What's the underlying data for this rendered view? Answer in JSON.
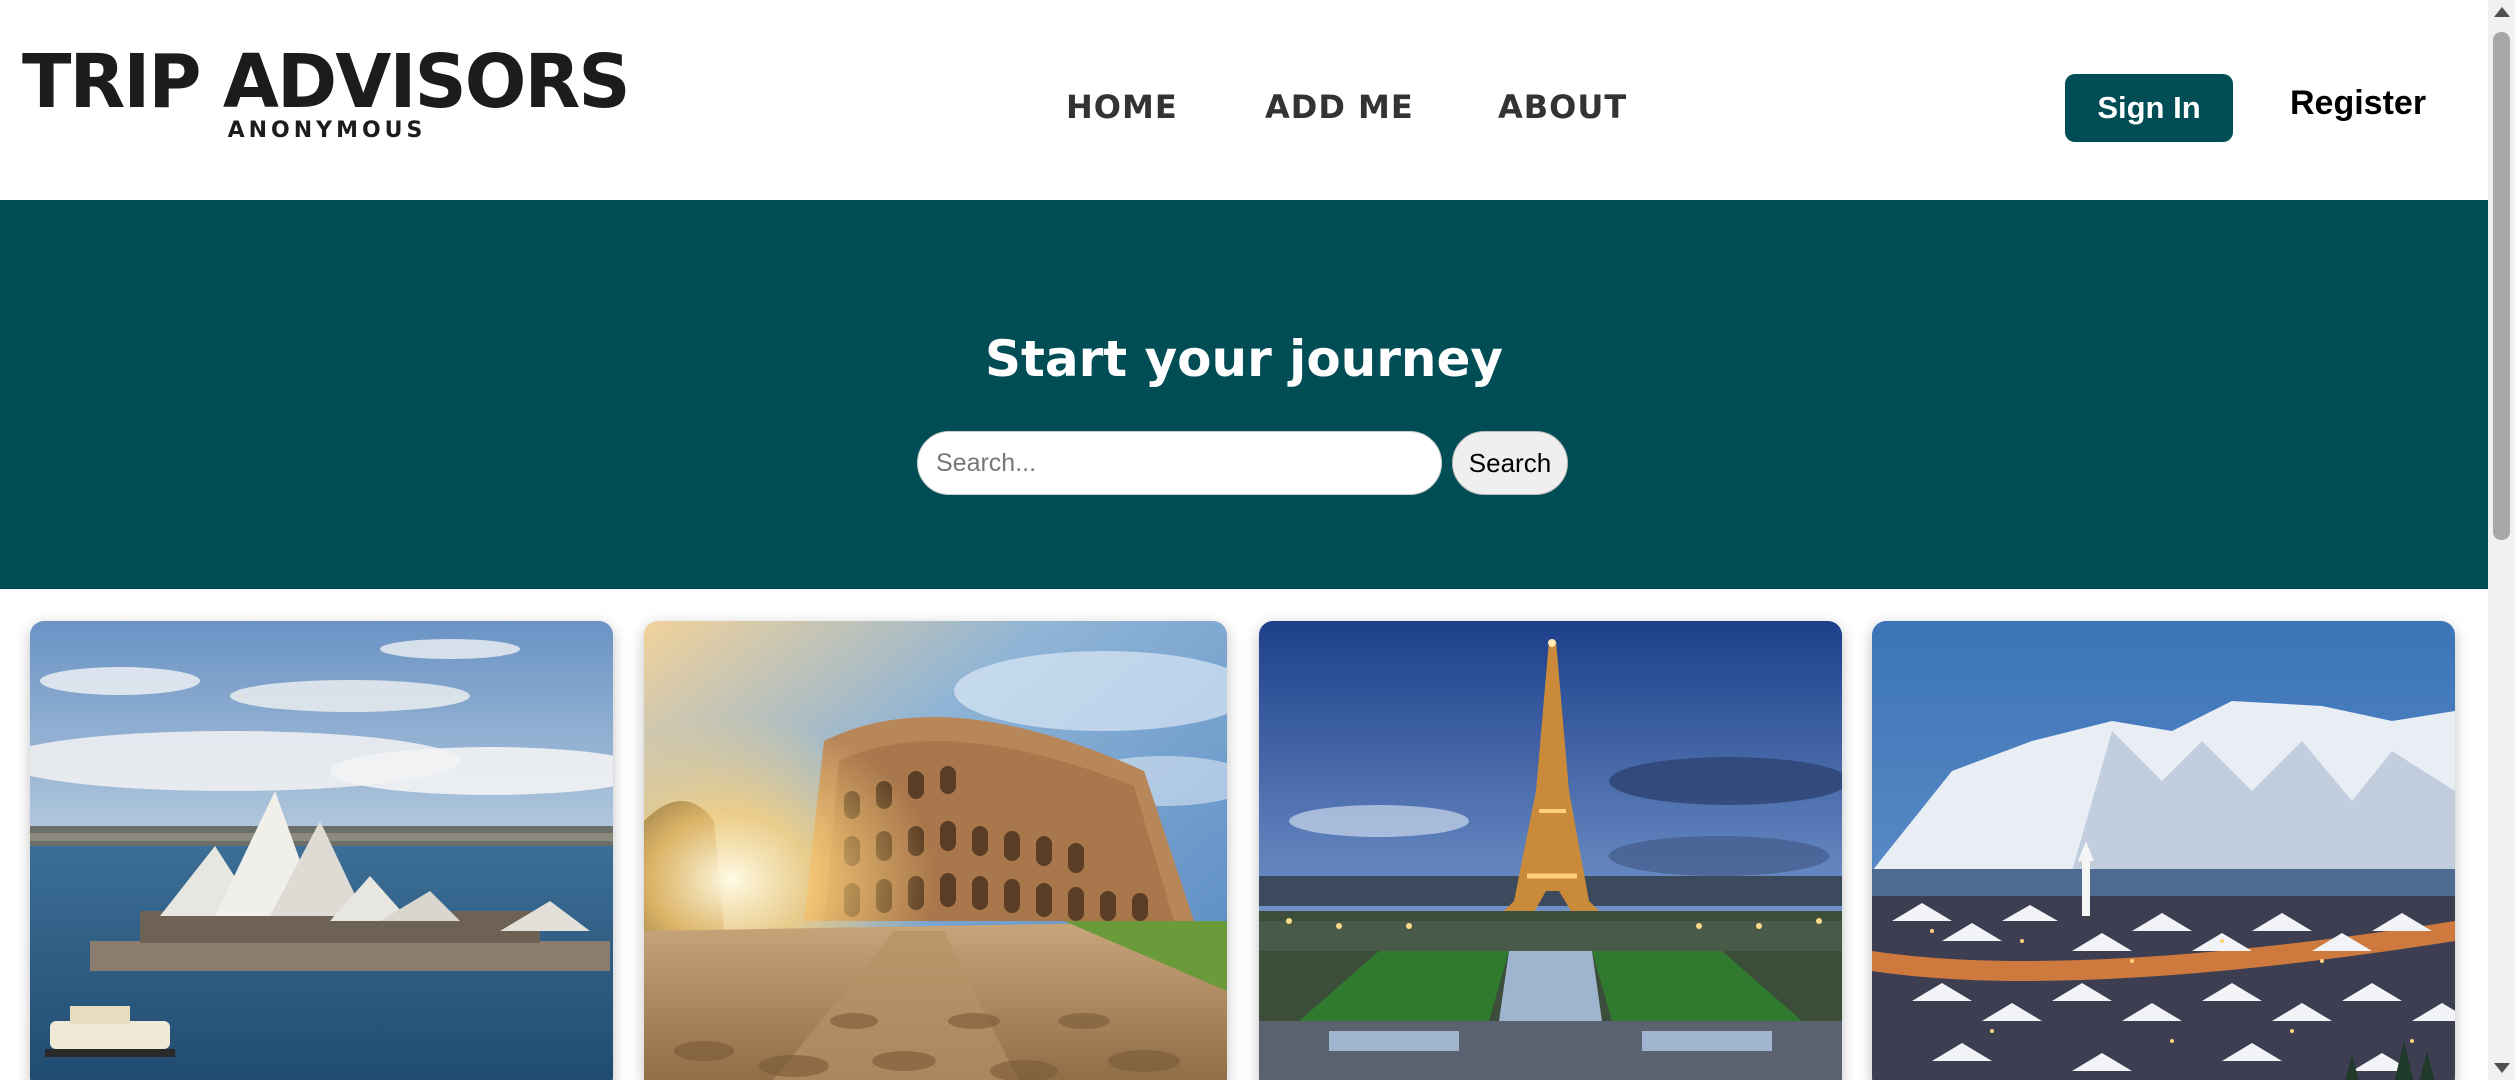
{
  "header": {
    "logo_title": "TRIP ADVISORS",
    "logo_subtitle": "ANONYMOUS",
    "nav": [
      {
        "label": "HOME"
      },
      {
        "label": "ADD ME"
      },
      {
        "label": "ABOUT"
      }
    ],
    "signin_label": "Sign In",
    "register_label": "Register"
  },
  "hero": {
    "title": "Start your journey",
    "search_placeholder": "Search...",
    "search_value": "",
    "search_button": "Search"
  },
  "cards": [
    {
      "image": "sydney-opera-house-photo"
    },
    {
      "image": "colosseum-rome-photo"
    },
    {
      "image": "eiffel-tower-paris-photo"
    },
    {
      "image": "reykjavik-winter-photo"
    }
  ],
  "colors": {
    "brand": "#004d55",
    "text_dark": "#1c1c1c",
    "nav_text": "#333333"
  }
}
